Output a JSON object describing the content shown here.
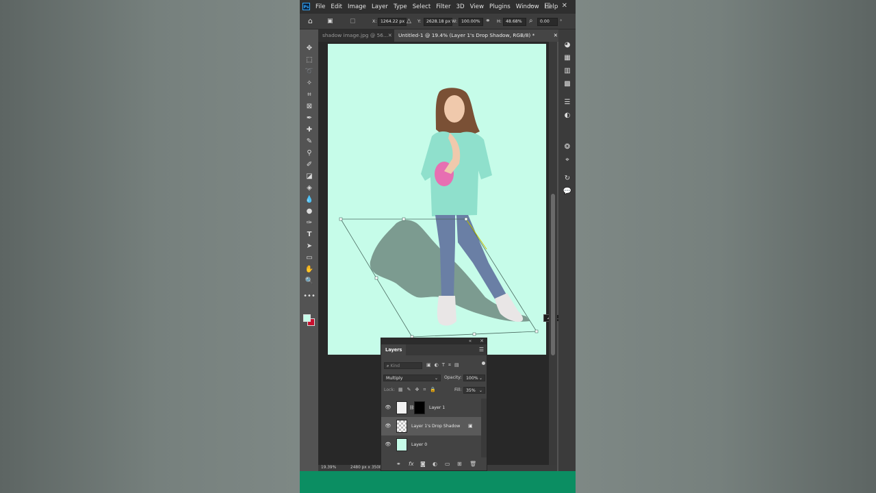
{
  "app": {
    "name": "Photoshop",
    "logo_text": "Ps"
  },
  "menu": [
    "File",
    "Edit",
    "Image",
    "Layer",
    "Type",
    "Select",
    "Filter",
    "3D",
    "View",
    "Plugins",
    "Window",
    "Help"
  ],
  "window_controls": {
    "minimize": "–",
    "maximize": "□",
    "close": "✕"
  },
  "options_bar": {
    "x_label": "X:",
    "x_value": "1264.22 px",
    "y_label": "Y:",
    "y_value": "2628.18 px",
    "w_label": "W:",
    "w_value": "100.00%",
    "h_label": "H:",
    "h_value": "48.68%",
    "angle_value": "0.00"
  },
  "tabs": [
    {
      "label": "shadow image.jpg @ 56...",
      "close": "✕"
    },
    {
      "label": "Untitled-1 @ 19.4% (Layer 1's Drop Shadow, RGB/8) *",
      "close": "✕"
    }
  ],
  "canvas": {
    "background": "#c6fce9",
    "shadow_color": "#6f8a80",
    "transform_angle": "31.2°"
  },
  "colors": {
    "foreground": "#c6fce9",
    "background": "#c8102e",
    "accent": "#31a8ff",
    "green_bar": "#0b8e62"
  },
  "status": {
    "zoom": "19.39%",
    "doc_size": "2480 px x 3508"
  },
  "layers_panel": {
    "title": "Layers",
    "filter_placeholder": "Kind",
    "blend_mode": "Multiply",
    "opacity_label": "Opacity:",
    "opacity_value": "100%",
    "lock_label": "Lock:",
    "fill_label": "Fill:",
    "fill_value": "35%",
    "layers": [
      {
        "name": "Layer 1",
        "visible": true
      },
      {
        "name": "Layer 1's Drop Shadow",
        "visible": true,
        "selected": true
      },
      {
        "name": "Layer 0",
        "visible": true
      }
    ]
  }
}
